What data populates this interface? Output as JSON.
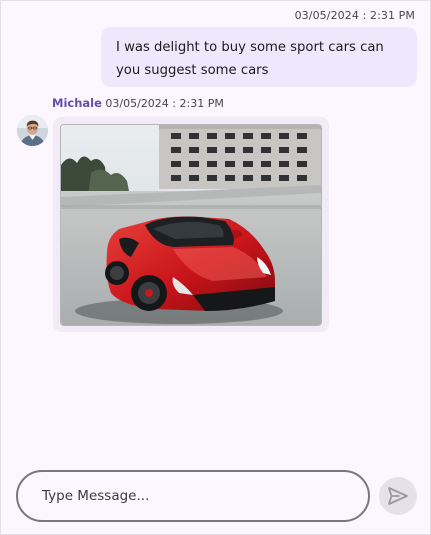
{
  "outgoing": {
    "timestamp": "03/05/2024 : 2:31 PM",
    "text": "I was delight to buy some sport cars can you suggest some cars"
  },
  "incoming": {
    "sender": "Michale",
    "timestamp": "03/05/2024 : 2:31 PM",
    "attachment_icon": "red-sports-car-photo"
  },
  "composer": {
    "placeholder": "Type Message...",
    "send_icon": "send-icon"
  },
  "colors": {
    "background": "#fcf7fe",
    "outgoing_bubble": "#efe8fc",
    "incoming_bubble": "#f1eaf7",
    "sender_name": "#6750a4",
    "send_button": "#e6e0e9"
  }
}
